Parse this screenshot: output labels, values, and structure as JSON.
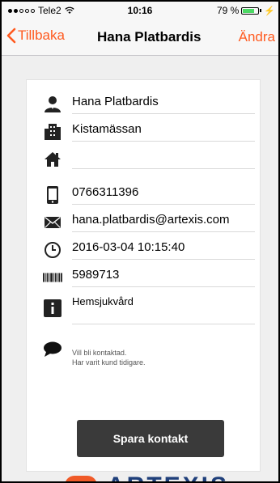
{
  "status_bar": {
    "carrier": "Tele2",
    "time": "10:16",
    "battery": "79 %",
    "battery_level": 0.79
  },
  "nav": {
    "back_label": "Tillbaka",
    "title": "Hana Platbardis",
    "edit_label": "Ändra"
  },
  "contact": {
    "name": "Hana Platbardis",
    "company": "Kistamässan",
    "address": "",
    "phone": "0766311396",
    "email": "hana.platbardis@artexis.com",
    "datetime": "2016-03-04 10:15:40",
    "barcode": "5989713",
    "info": "Hemsjukvård",
    "notes": [
      "Vill bli kontaktad.",
      "Har varit kund tidigare."
    ]
  },
  "actions": {
    "save_label": "Spara kontakt"
  },
  "brand": {
    "logo_text": "ARTEXIS"
  },
  "colors": {
    "accent": "#ff5a1f",
    "button_dark": "#3a3a3a",
    "logo_orange": "#f05a28",
    "logo_blue": "#1f3f7a"
  },
  "icons": [
    "person-icon",
    "building-icon",
    "home-icon",
    "phone-icon",
    "mail-icon",
    "clock-icon",
    "barcode-icon",
    "info-icon",
    "speech-bubble-icon",
    "chevron-left-icon"
  ]
}
